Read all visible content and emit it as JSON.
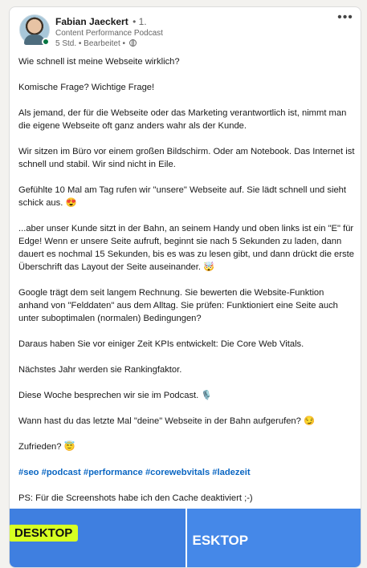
{
  "author": {
    "name": "Fabian Jaeckert",
    "degree": "• 1.",
    "headline": "Content Performance Podcast",
    "meta": "5 Std. • Bearbeitet •",
    "avatar_icon": "profile-photo",
    "more_icon": "more-horizontal-icon",
    "status_color": "#057642"
  },
  "post": {
    "paragraphs": [
      "Wie schnell ist meine Webseite wirklich?",
      "Komische Frage? Wichtige Frage!",
      "Als jemand, der für die Webseite oder das Marketing verantwortlich ist, nimmt man die eigene Webseite oft ganz anders wahr als der Kunde.",
      "Wir sitzen im Büro vor einem großen Bildschirm. Oder am Notebook. Das Internet ist schnell und stabil. Wir sind nicht in Eile.",
      "Gefühlte 10 Mal am Tag rufen wir \"unsere\" Webseite auf. Sie lädt schnell und sieht schick aus. 😍",
      "...aber unser Kunde sitzt in der Bahn, an seinem Handy und oben links ist ein \"E\" für Edge! Wenn er unsere Seite aufruft, beginnt sie nach 5 Sekunden zu laden, dann dauert es nochmal 15 Sekunden, bis es was zu lesen gibt, und dann drückt die erste Überschrift das Layout der Seite auseinander. 🤯",
      "Google trägt dem seit langem Rechnung. Sie bewerten die Website-Funktion anhand von \"Felddaten\" aus dem Alltag. Sie prüfen: Funktioniert eine Seite auch unter suboptimalen (normalen) Bedingungen?",
      "Daraus haben Sie vor einiger Zeit KPIs entwickelt: Die Core Web Vitals.",
      "Nächstes Jahr werden sie Rankingfaktor.",
      "Diese Woche besprechen wir sie im Podcast. 🎙️",
      "Wann hast du das letzte Mal \"deine\" Webseite in der Bahn aufgerufen? 😏",
      "Zufrieden? 😇"
    ],
    "hashtags": [
      "#seo",
      "#podcast",
      "#performance",
      "#corewebvitals",
      "#ladezeit"
    ],
    "ps": "PS: Für die Screenshots habe ich den Cache deaktiviert ;-)"
  },
  "images": {
    "left_label": "DESKTOP",
    "right_label": "ESKTOP",
    "highlight_color": "#d7ff22",
    "image_color": "#3f7fe0"
  }
}
